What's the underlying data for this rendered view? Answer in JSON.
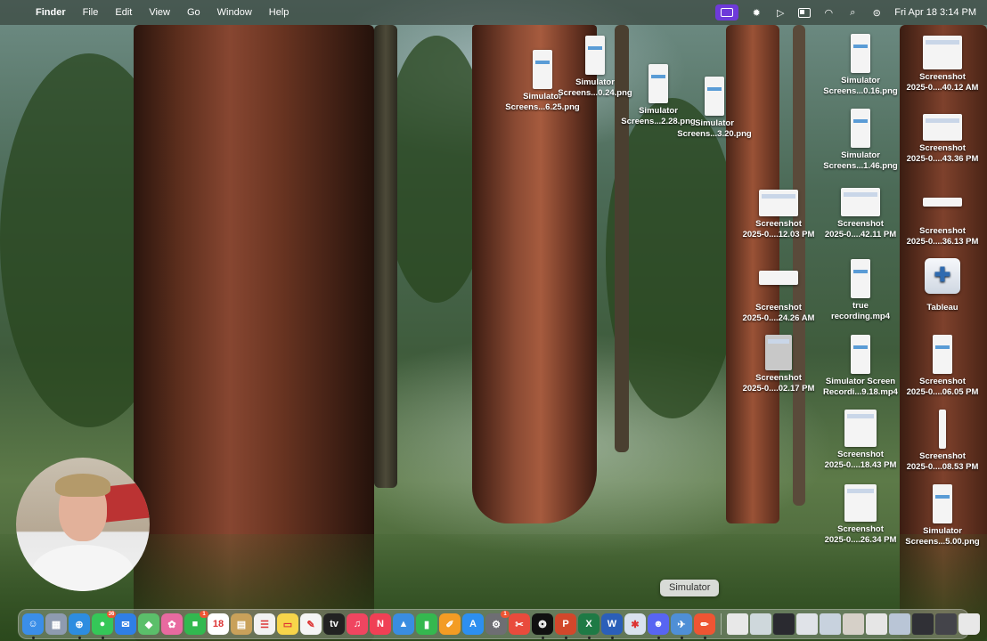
{
  "menubar": {
    "app_name": "Finder",
    "menus": [
      "File",
      "Edit",
      "View",
      "Go",
      "Window",
      "Help"
    ],
    "datetime": "Fri Apr 18  3:14 PM"
  },
  "desktop_icons": [
    {
      "line1": "Simulator",
      "line2": "Screens...6.25.png",
      "kind": "phone"
    },
    {
      "line1": "Simulator",
      "line2": "Screens...0.24.png",
      "kind": "phone"
    },
    {
      "line1": "Simulator",
      "line2": "Screens...2.28.png",
      "kind": "phone"
    },
    {
      "line1": "Simulator",
      "line2": "Screens...3.20.png",
      "kind": "phone"
    },
    {
      "line1": "Simulator",
      "line2": "Screens...0.16.png",
      "kind": "phone"
    },
    {
      "line1": "Screenshot",
      "line2": "2025-0....40.12 AM",
      "kind": "wide"
    },
    {
      "line1": "Simulator",
      "line2": "Screens...1.46.png",
      "kind": "phone"
    },
    {
      "line1": "Screenshot",
      "line2": "2025-0....43.36 PM",
      "kind": "wide"
    },
    {
      "line1": "Screenshot",
      "line2": "2025-0....12.03 PM",
      "kind": "wide"
    },
    {
      "line1": "Screenshot",
      "line2": "2025-0....42.11 PM",
      "kind": "wide"
    },
    {
      "line1": "Screenshot",
      "line2": "2025-0....36.13 PM",
      "kind": "strip"
    },
    {
      "line1": "Screenshot",
      "line2": "2025-0....24.26 AM",
      "kind": "strip"
    },
    {
      "line1": "true",
      "line2": "recording.mp4",
      "kind": "phone"
    },
    {
      "line1": "Tableau",
      "line2": "",
      "kind": "tableau"
    },
    {
      "line1": "Screenshot",
      "line2": "2025-0....02.17 PM",
      "kind": "phone"
    },
    {
      "line1": "Simulator Screen",
      "line2": "Recordi...9.18.mp4",
      "kind": "phone"
    },
    {
      "line1": "Screenshot",
      "line2": "2025-0....06.05 PM",
      "kind": "phone"
    },
    {
      "line1": "Screenshot",
      "line2": "2025-0....18.43 PM",
      "kind": "wide"
    },
    {
      "line1": "Screenshot",
      "line2": "2025-0....08.53 PM",
      "kind": "thin"
    },
    {
      "line1": "Screenshot",
      "line2": "2025-0....26.34 PM",
      "kind": "wide"
    },
    {
      "line1": "Simulator",
      "line2": "Screens...5.00.png",
      "kind": "phone"
    }
  ],
  "tooltip": "Simulator",
  "dock": {
    "apps": [
      {
        "name": "finder-icon",
        "color": "#3b8ee8",
        "glyph": "☺",
        "running": true
      },
      {
        "name": "launchpad-icon",
        "color": "#8e9bb0",
        "glyph": "▦",
        "running": false
      },
      {
        "name": "safari-icon",
        "color": "#2d8de0",
        "glyph": "⊕",
        "running": true
      },
      {
        "name": "messages-icon",
        "color": "#35c758",
        "glyph": "●",
        "running": true,
        "badge": "36"
      },
      {
        "name": "mail-icon",
        "color": "#2f7fe6",
        "glyph": "✉",
        "running": false
      },
      {
        "name": "maps-icon",
        "color": "#5bbf6a",
        "glyph": "◆",
        "running": false
      },
      {
        "name": "photos-icon",
        "color": "#e86aa0",
        "glyph": "✿",
        "running": false
      },
      {
        "name": "facetime-icon",
        "color": "#32b94f",
        "glyph": "■",
        "running": false,
        "badge": "1"
      },
      {
        "name": "calendar-icon",
        "color": "#ffffff",
        "glyph": "18",
        "running": false
      },
      {
        "name": "notes-folder-icon",
        "color": "#c9a15a",
        "glyph": "▤",
        "running": false
      },
      {
        "name": "reminders-icon",
        "color": "#f2f2f2",
        "glyph": "☰",
        "running": false
      },
      {
        "name": "notes-icon",
        "color": "#f7d54a",
        "glyph": "▭",
        "running": false
      },
      {
        "name": "freeform-icon",
        "color": "#f5f5f5",
        "glyph": "✎",
        "running": false
      },
      {
        "name": "tv-icon",
        "color": "#222222",
        "glyph": "tv",
        "running": false
      },
      {
        "name": "music-icon",
        "color": "#f04560",
        "glyph": "♫",
        "running": false
      },
      {
        "name": "news-icon",
        "color": "#f04055",
        "glyph": "N",
        "running": false
      },
      {
        "name": "keynote-icon",
        "color": "#3a8de0",
        "glyph": "▲",
        "running": false
      },
      {
        "name": "numbers-icon",
        "color": "#35b84f",
        "glyph": "▮",
        "running": false
      },
      {
        "name": "pages-icon",
        "color": "#f39c24",
        "glyph": "✐",
        "running": false
      },
      {
        "name": "app-store-icon",
        "color": "#2d8ff0",
        "glyph": "A",
        "running": false
      },
      {
        "name": "system-settings-icon",
        "color": "#6e6e73",
        "glyph": "⚙",
        "running": false,
        "badge": "1"
      },
      {
        "name": "pdf-viewer-icon",
        "color": "#e94b3c",
        "glyph": "✂",
        "running": false
      },
      {
        "name": "chatgpt-icon",
        "color": "#101010",
        "glyph": "❂",
        "running": true
      },
      {
        "name": "powerpoint-icon",
        "color": "#d2472b",
        "glyph": "P",
        "running": true
      },
      {
        "name": "excel-icon",
        "color": "#1e7a45",
        "glyph": "X",
        "running": true
      },
      {
        "name": "word-icon",
        "color": "#2b5fb9",
        "glyph": "W",
        "running": true
      },
      {
        "name": "xcode-icon",
        "color": "#d9e2ef",
        "glyph": "✱",
        "running": false
      },
      {
        "name": "discord-icon",
        "color": "#5865f2",
        "glyph": "☻",
        "running": true
      },
      {
        "name": "simulator-icon",
        "color": "#4f8fd6",
        "glyph": "✈",
        "running": true
      },
      {
        "name": "pen-app-icon",
        "color": "#ee5533",
        "glyph": "✏",
        "running": true
      }
    ],
    "recents": [
      {
        "name": "document-icon",
        "color": "#e8e8e8"
      },
      {
        "name": "file-thumbnail-icon",
        "color": "#cfd8dc"
      },
      {
        "name": "screen-thumbnail-icon",
        "color": "#2a2a30"
      },
      {
        "name": "screenshot-thumbnail-icon",
        "color": "#e0e3e8"
      },
      {
        "name": "screenshot-thumbnail-icon",
        "color": "#c8d2de"
      },
      {
        "name": "folder-thumbnail-icon",
        "color": "#d6d0c8"
      },
      {
        "name": "screenshot-thumbnail-icon",
        "color": "#e6e6e6"
      },
      {
        "name": "screenshot-thumbnail-icon",
        "color": "#b9c5d6"
      },
      {
        "name": "screen-thumbnail-icon",
        "color": "#303036"
      },
      {
        "name": "screen-thumbnail-icon",
        "color": "#44444a"
      }
    ],
    "trash": {
      "name": "trash-icon",
      "color": "#e8e8e8"
    }
  }
}
